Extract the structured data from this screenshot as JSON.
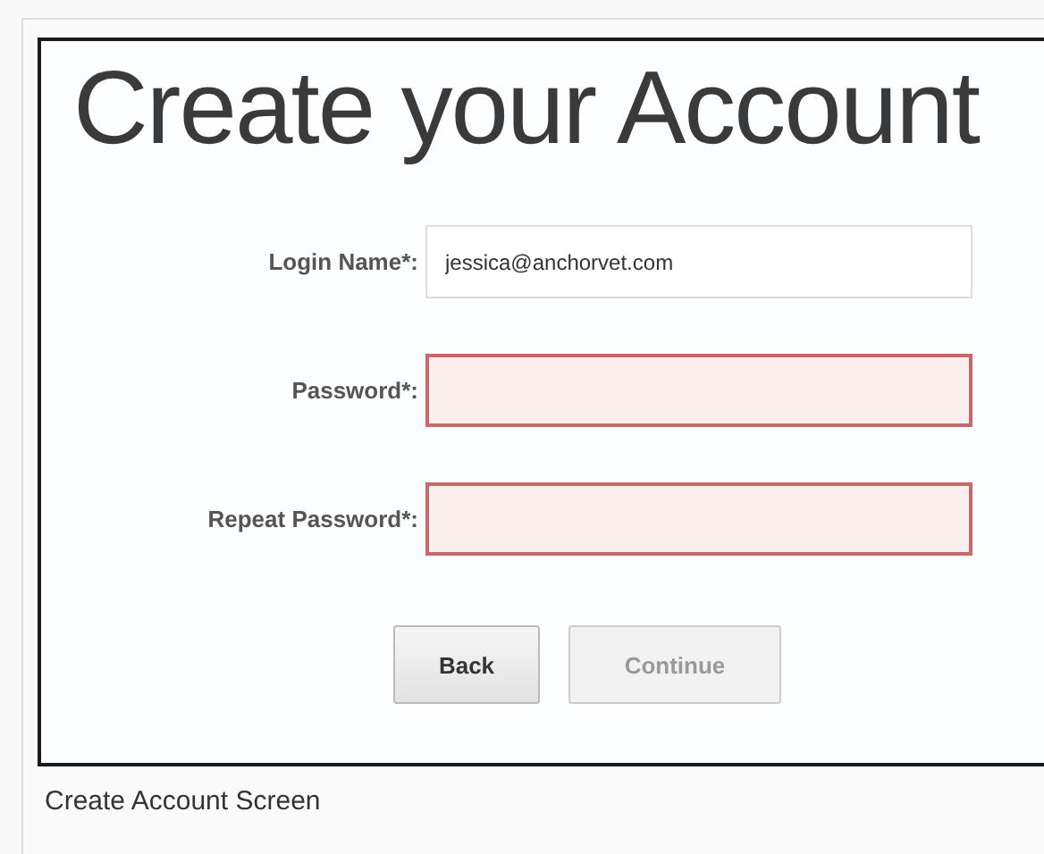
{
  "heading": "Create your Account",
  "fields": [
    {
      "label": "Login Name*:",
      "value": "jessica@anchorvet.com",
      "invalid": false
    },
    {
      "label": "Password*:",
      "invalid": true
    },
    {
      "label": "Repeat Password*:",
      "invalid": true
    }
  ],
  "buttons": [
    {
      "label": "Back",
      "disabled": false
    },
    {
      "label": "Continue",
      "disabled": true
    }
  ],
  "caption": "Create Account Screen"
}
